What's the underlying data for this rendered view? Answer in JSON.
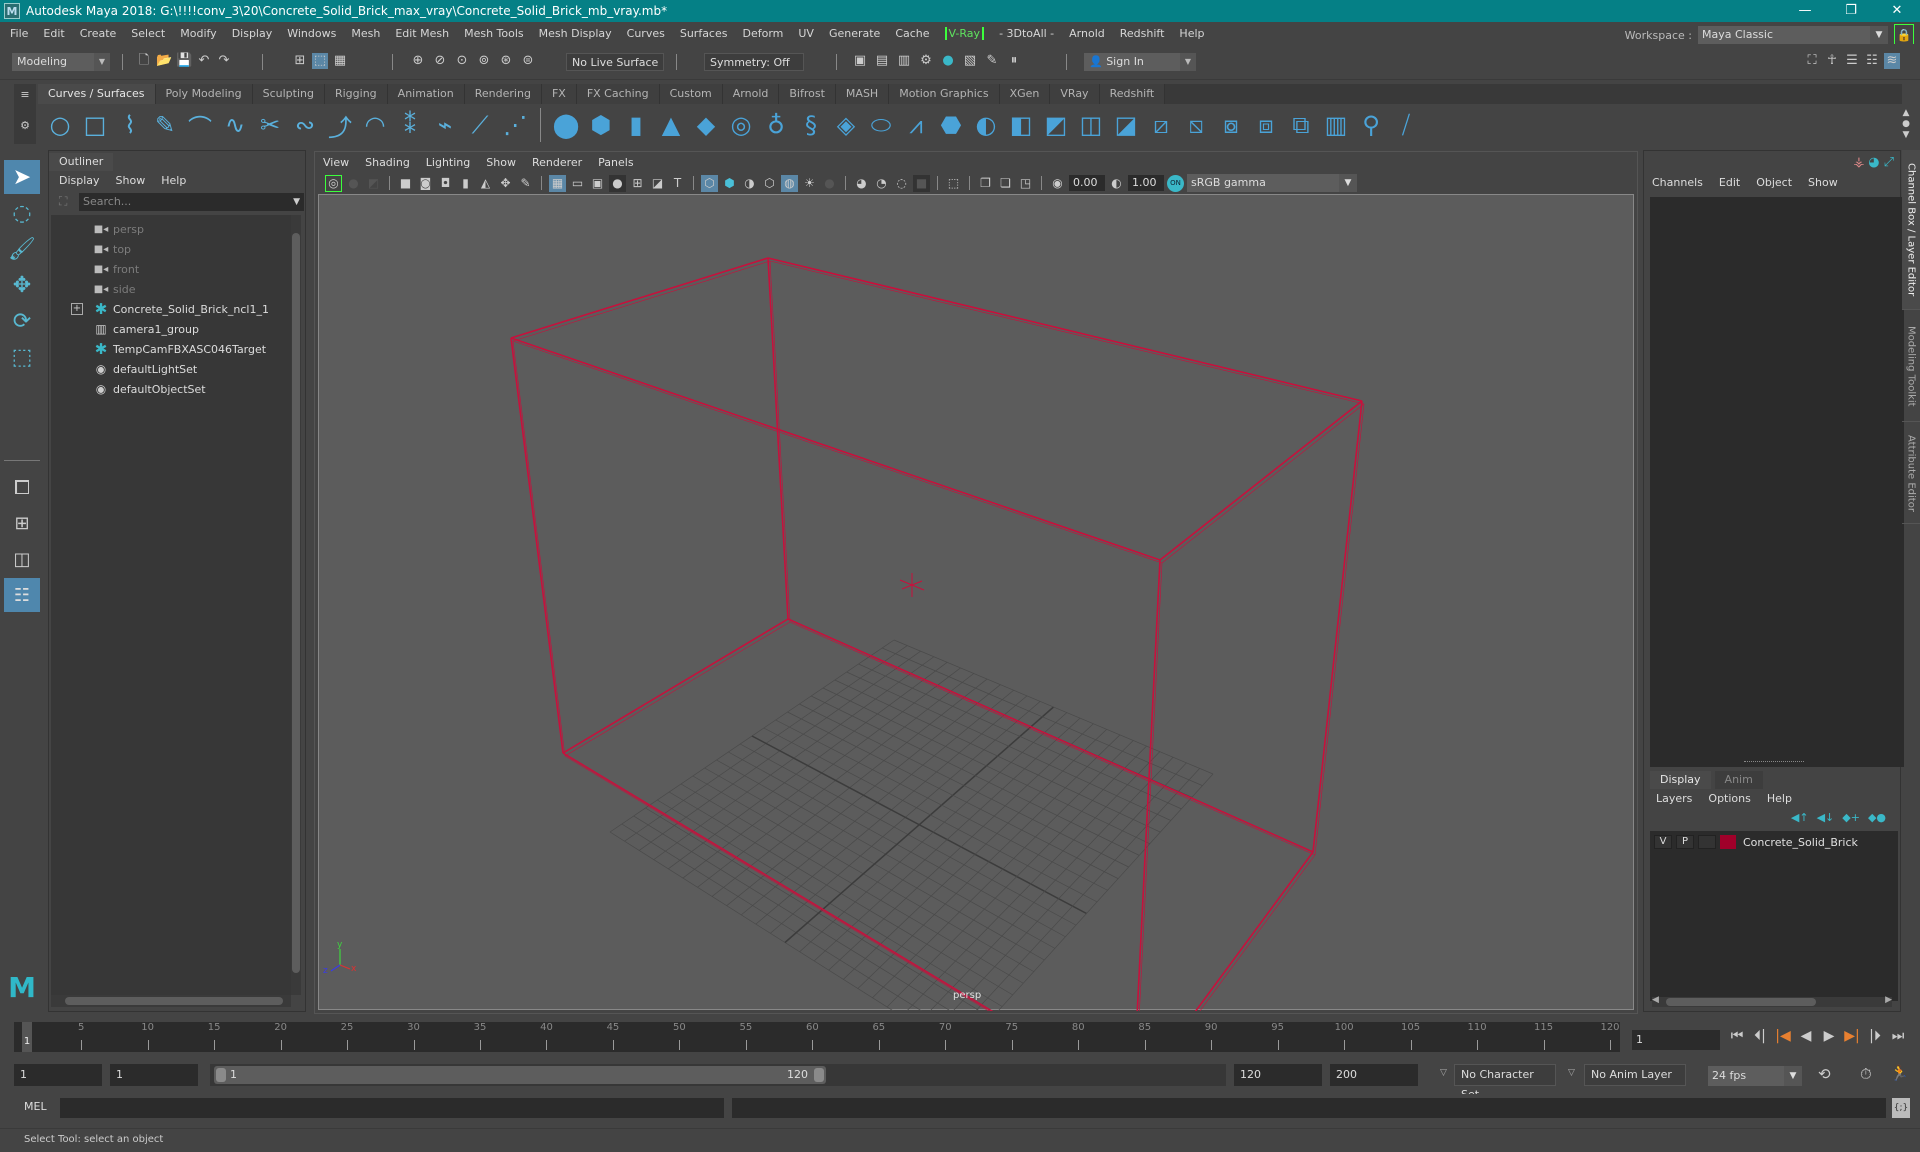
{
  "window": {
    "title": "Autodesk Maya 2018: G:\\!!!!conv_3\\20\\Concrete_Solid_Brick_max_vray\\Concrete_Solid_Brick_mb_vray.mb*",
    "logo": "M",
    "controls": {
      "minimize": "—",
      "restore": "❐",
      "close": "✕"
    }
  },
  "menubar": {
    "items": [
      "File",
      "Edit",
      "Create",
      "Select",
      "Modify",
      "Display",
      "Windows",
      "Mesh",
      "Edit Mesh",
      "Mesh Tools",
      "Mesh Display",
      "Curves",
      "Surfaces",
      "Deform",
      "UV",
      "Generate",
      "Cache",
      "V-Ray",
      "- 3DtoAll -",
      "Arnold",
      "Redshift",
      "Help"
    ],
    "workspace_label": "Workspace :",
    "workspace_value": "Maya Classic"
  },
  "statusline": {
    "mode": "Modeling",
    "live_surface": "No Live Surface",
    "symmetry": "Symmetry: Off",
    "sign_in": "Sign In"
  },
  "shelf": {
    "tabs": [
      "Curves / Surfaces",
      "Poly Modeling",
      "Sculpting",
      "Rigging",
      "Animation",
      "Rendering",
      "FX",
      "FX Caching",
      "Custom",
      "Arnold",
      "Bifrost",
      "MASH",
      "Motion Graphics",
      "XGen",
      "VRay",
      "Redshift"
    ],
    "active_tab": "Curves / Surfaces"
  },
  "outliner": {
    "title": "Outliner",
    "menus": [
      "Display",
      "Show",
      "Help"
    ],
    "search_placeholder": "Search...",
    "items": [
      {
        "label": "persp",
        "icon": "camera-icon",
        "dim": true,
        "expandable": false
      },
      {
        "label": "top",
        "icon": "camera-icon",
        "dim": true,
        "expandable": false
      },
      {
        "label": "front",
        "icon": "camera-icon",
        "dim": true,
        "expandable": false
      },
      {
        "label": "side",
        "icon": "camera-icon",
        "dim": true,
        "expandable": false
      },
      {
        "label": "Concrete_Solid_Brick_ncl1_1",
        "icon": "joint-icon",
        "dim": false,
        "expandable": true
      },
      {
        "label": "camera1_group",
        "icon": "group-icon",
        "dim": false,
        "expandable": false
      },
      {
        "label": "TempCamFBXASC046Target",
        "icon": "joint-icon",
        "dim": false,
        "expandable": false
      },
      {
        "label": "defaultLightSet",
        "icon": "set-icon",
        "dim": false,
        "expandable": false
      },
      {
        "label": "defaultObjectSet",
        "icon": "set-icon",
        "dim": false,
        "expandable": false
      }
    ]
  },
  "viewport": {
    "menus": [
      "View",
      "Shading",
      "Lighting",
      "Show",
      "Renderer",
      "Panels"
    ],
    "exposure": "0.00",
    "gamma": "1.00",
    "color_space": "sRGB gamma",
    "camera_label": "persp",
    "wireframe_color": "#c8103c",
    "axis": {
      "x": "x",
      "y": "y",
      "z": "z"
    }
  },
  "channelbox": {
    "menus": [
      "Channels",
      "Edit",
      "Object",
      "Show"
    ],
    "layer_tabs": [
      "Display",
      "Anim"
    ],
    "active_layer_tab": "Display",
    "layer_menus": [
      "Layers",
      "Options",
      "Help"
    ],
    "layers": [
      {
        "v": "V",
        "p": "P",
        "name": "Concrete_Solid_Brick",
        "color": "#a0002a"
      }
    ],
    "side_tabs": [
      "Channel Box / Layer Editor",
      "Modeling Toolkit",
      "Attribute Editor"
    ]
  },
  "timeslider": {
    "start": 1,
    "end": 120,
    "step": 5,
    "current_frame": "1",
    "current_frame_field": "1"
  },
  "range": {
    "start_time": "1",
    "playback_start": "1",
    "range_start_label": "1",
    "range_end_label": "120",
    "playback_end": "120",
    "end_time": "200",
    "character_set": "No Character Set",
    "anim_layer": "No Anim Layer",
    "fps": "24 fps"
  },
  "mel": {
    "label": "MEL"
  },
  "helpline": {
    "text": "Select Tool: select an object"
  }
}
